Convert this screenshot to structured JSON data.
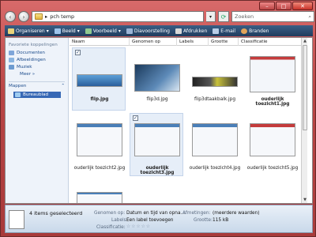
{
  "address": {
    "path": "pch temp",
    "search_placeholder": "Zoeken"
  },
  "toolbar": {
    "items": [
      "Organiseren",
      "Beeld",
      "Voorbeeld",
      "Diavoorstelling",
      "Afdrukken",
      "E-mail",
      "Branden"
    ]
  },
  "nav": {
    "header": "Favoriete koppelingen",
    "links": [
      "Documenten",
      "Afbeeldingen",
      "Muziek"
    ],
    "more": "Meer",
    "folders_label": "Mappen",
    "desktop": "Bureaublad"
  },
  "columns": [
    "Naam",
    "Genomen op",
    "Labels",
    "Grootte",
    "Classificatie"
  ],
  "files": [
    {
      "name": "flip.jpg",
      "selected": true
    },
    {
      "name": "flip3d.jpg",
      "selected": false
    },
    {
      "name": "flip3dtaakbalk.jpg",
      "selected": false
    },
    {
      "name": "ouderlijk toezicht1.jpg",
      "selected": false
    },
    {
      "name": "ouderlijk toezicht2.jpg",
      "selected": false
    },
    {
      "name": "ouderlijk toezicht3.jpg",
      "selected": true
    },
    {
      "name": "ouderlijk toezicht4.jpg",
      "selected": false
    },
    {
      "name": "ouderlijk toezicht5.jpg",
      "selected": false
    }
  ],
  "details": {
    "count": "4 items geselecteerd",
    "taken_label": "Genomen op:",
    "taken_value": "Datum en tijd van opna...",
    "dims_label": "Afmetingen:",
    "dims_value": "(meerdere waarden)",
    "labels_label": "Labels:",
    "labels_value": "Een label toevoegen",
    "size_label": "Grootte:",
    "size_value": "115 kB",
    "rating_label": "Classificatie:",
    "rating_stars": "☆☆☆☆☆"
  },
  "colors": {
    "titlebar": "#b94545",
    "toolbar": "#1f3c5e",
    "nav_bg": "#eef3fa",
    "selection": "#3768b5"
  }
}
